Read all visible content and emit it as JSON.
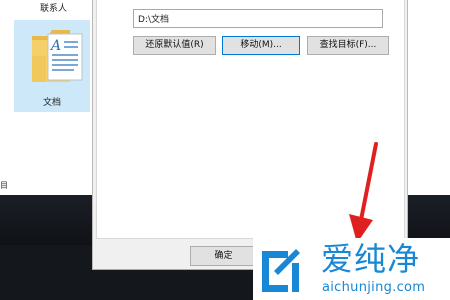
{
  "explorer": {
    "contacts_label": "联系人",
    "document_label": "文档",
    "selected_strip_text": "目"
  },
  "dialog": {
    "path_value": "D:\\文档",
    "restore_default_label": "还原默认值(R)",
    "move_label": "移动(M)...",
    "find_target_label": "查找目标(F)...",
    "ok_label": "确定"
  },
  "watermark": {
    "brand_cn": "爱纯净",
    "url": "aichunjing.com"
  },
  "colors": {
    "accent_focus": "#0078d7",
    "arrow": "#e02020",
    "watermark_blue": "#1787d6",
    "taskbar": "#14171c"
  },
  "icons": {
    "folder": "documents-folder-icon",
    "logo": "aichunjing-logo-icon",
    "arrow": "red-pointer-arrow"
  }
}
